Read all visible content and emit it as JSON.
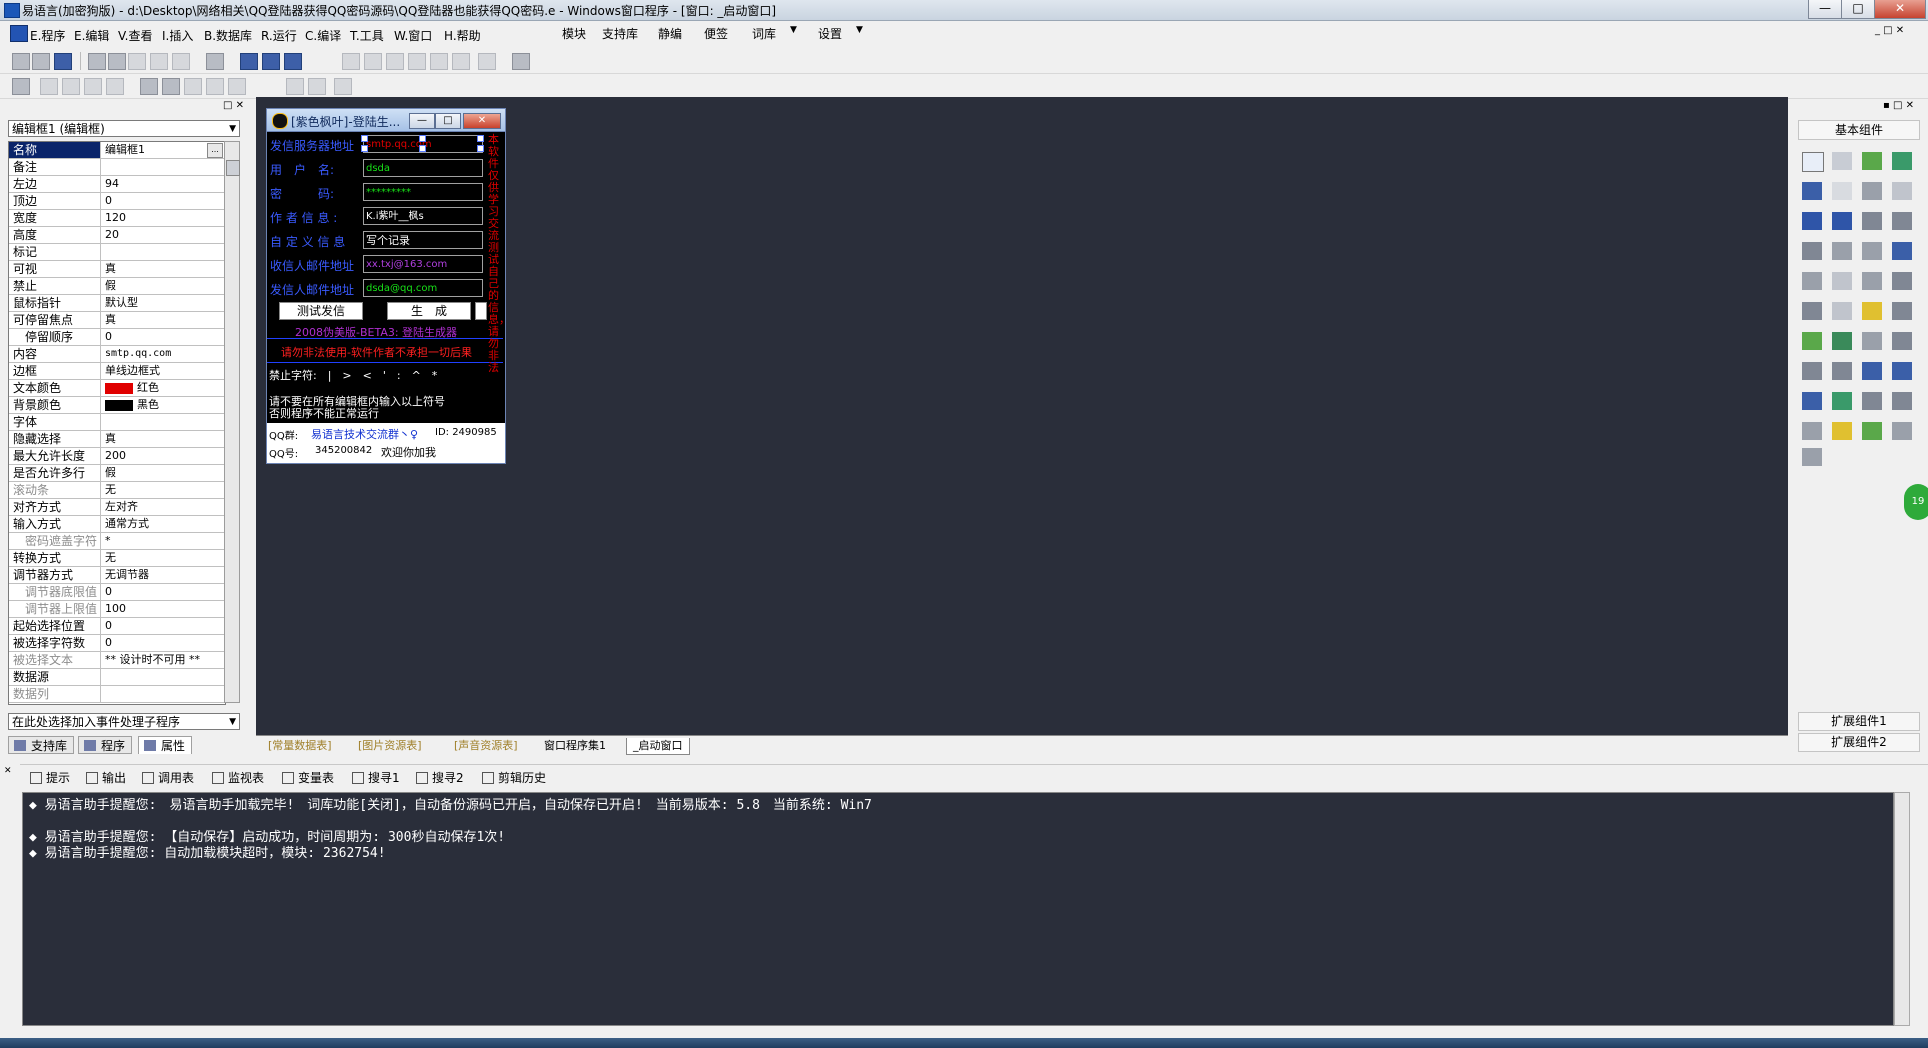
{
  "window": {
    "title": "易语言(加密狗版) - d:\\Desktop\\网络相关\\QQ登陆器获得QQ密码源码\\QQ登陆器也能获得QQ密码.e - Windows窗口程序 - [窗口: _启动窗口]",
    "minimize": "—",
    "maximize": "□",
    "close": "✕"
  },
  "menu": {
    "items": [
      "E.程序",
      "E.编辑",
      "V.查看",
      "I.插入",
      "B.数据库",
      "R.运行",
      "C.编译",
      "T.工具",
      "W.窗口",
      "H.帮助"
    ],
    "extras": [
      "模块",
      "支持库",
      "静编",
      "便签",
      "词库",
      "▼",
      "设置",
      "▼"
    ]
  },
  "left_panel": {
    "object_select": "编辑框1 (编辑框)",
    "properties": [
      {
        "name": "名称",
        "value": "编辑框1"
      },
      {
        "name": "备注",
        "value": ""
      },
      {
        "name": "左边",
        "value": "94"
      },
      {
        "name": "顶边",
        "value": "0"
      },
      {
        "name": "宽度",
        "value": "120"
      },
      {
        "name": "高度",
        "value": "20"
      },
      {
        "name": "标记",
        "value": ""
      },
      {
        "name": "可视",
        "value": "真"
      },
      {
        "name": "禁止",
        "value": "假"
      },
      {
        "name": "鼠标指针",
        "value": "默认型"
      },
      {
        "name": "可停留焦点",
        "value": "真"
      },
      {
        "name": "停留顺序",
        "value": "0"
      },
      {
        "name": "内容",
        "value": "smtp.qq.com"
      },
      {
        "name": "边框",
        "value": "单线边框式"
      },
      {
        "name": "文本颜色",
        "value": "红色"
      },
      {
        "name": "背景颜色",
        "value": "黑色"
      },
      {
        "name": "字体",
        "value": ""
      },
      {
        "name": "隐藏选择",
        "value": "真"
      },
      {
        "name": "最大允许长度",
        "value": "200"
      },
      {
        "name": "是否允许多行",
        "value": "假"
      },
      {
        "name": "滚动条",
        "value": "无"
      },
      {
        "name": "对齐方式",
        "value": "左对齐"
      },
      {
        "name": "输入方式",
        "value": "通常方式"
      },
      {
        "name": "密码遮盖字符",
        "value": "*"
      },
      {
        "name": "转换方式",
        "value": "无"
      },
      {
        "name": "调节器方式",
        "value": "无调节器"
      },
      {
        "name": "调节器底限值",
        "value": "0"
      },
      {
        "name": "调节器上限值",
        "value": "100"
      },
      {
        "name": "起始选择位置",
        "value": "0"
      },
      {
        "name": "被选择字符数",
        "value": "0"
      },
      {
        "name": "被选择文本",
        "value": "** 设计时不可用 **"
      },
      {
        "name": "数据源",
        "value": ""
      },
      {
        "name": "数据列",
        "value": ""
      }
    ],
    "text_color": "#e00000",
    "bg_color": "#000000",
    "event_select": "在此处选择加入事件处理子程序",
    "tabs": [
      "支持库",
      "程序",
      "属性"
    ]
  },
  "form": {
    "title": "[紫色枫叶]-登陆生...",
    "labels": [
      "发信服务器地址",
      "用　户　名:",
      "密　　　码:",
      "作 者 信 息 :",
      "自 定 义 信 息",
      "收信人邮件地址",
      "发信人邮件地址"
    ],
    "edits": [
      "smtp.qq.com",
      "dsda",
      "*********",
      "K.i紫叶__枫s",
      "写个记录",
      "xx.txj@163.com",
      "dsda@qq.com"
    ],
    "button_test": "测试发信",
    "button_generate": "生　成",
    "version": "2008伪美版-BETA3: 登陆生成器",
    "warning": "请勿非法使用-软件作者不承担一切后果",
    "forbidden": "禁止字符:　|　>　<　'　:　^　*",
    "notice_line1": "请不要在所有编辑框内输入以上符号",
    "notice_line2": "否则程序不能正常运行",
    "qq_group_label": "QQ群:",
    "qq_group_link": "易语言技术交流群丶♀",
    "qq_group_id": "ID: 2490985",
    "qq_label": "QQ号:",
    "qq_number": "345200842",
    "qq_welcome": "欢迎你加我",
    "vertical_text": "本软件仅供学习交流测试自己的信息，请勿非法"
  },
  "design_tabs": [
    "[常量数据表]",
    "[图片资源表]",
    "[声音资源表]",
    "窗口程序集1",
    "_启动窗口"
  ],
  "palette": {
    "header": "基本组件",
    "ext1": "扩展组件1",
    "ext2": "扩展组件2",
    "badge": "19"
  },
  "output_tabs": [
    "提示",
    "输出",
    "调用表",
    "监视表",
    "变量表",
    "搜寻1",
    "搜寻2",
    "剪辑历史"
  ],
  "output_lines": [
    "◆ 易语言助手提醒您:　易语言助手加载完毕!　词库功能[关闭]，自动备份源码已开启，自动保存已开启!　当前易版本: 5.8　当前系统: Win7",
    "◆ 易语言助手提醒您: 【自动保存】启动成功，时间周期为: 300秒自动保存1次!",
    "◆ 易语言助手提醒您: 自动加载模块超时，模块: 2362754!"
  ]
}
